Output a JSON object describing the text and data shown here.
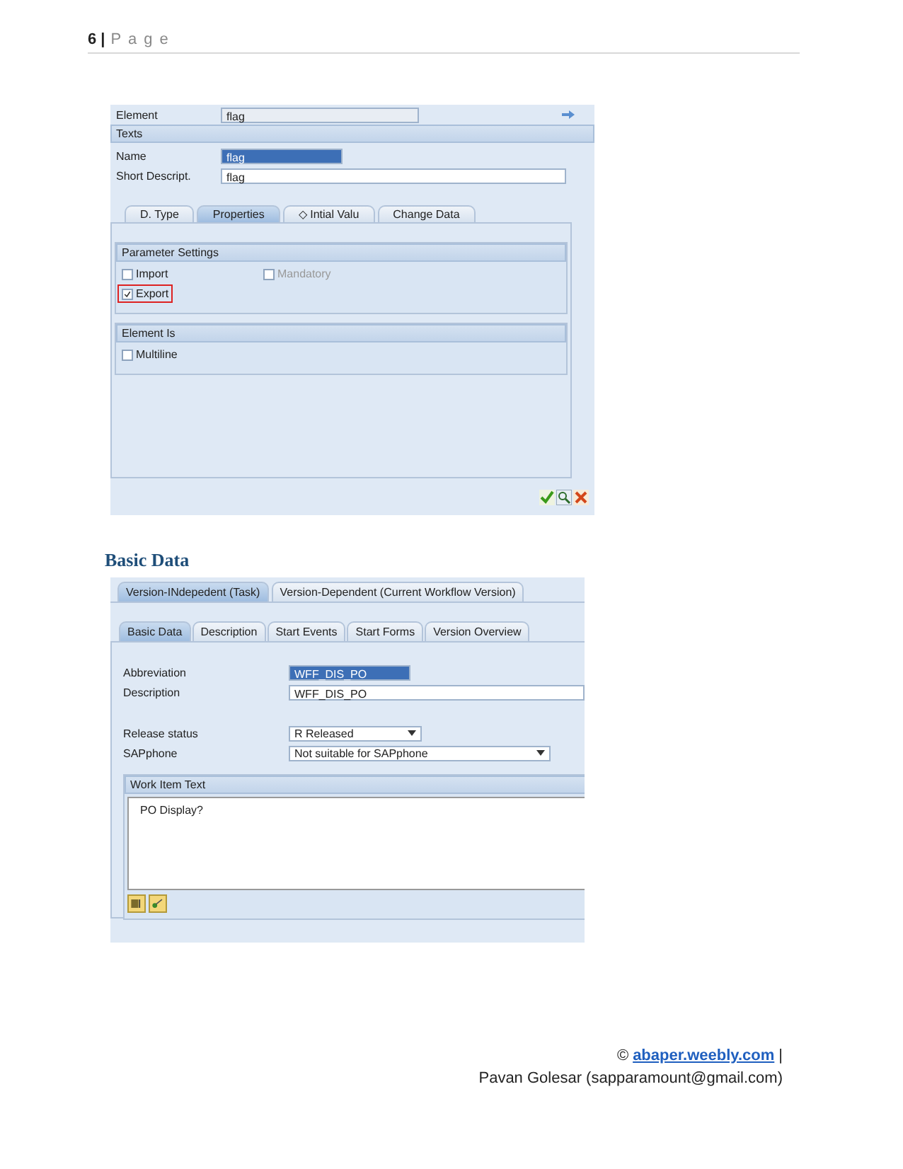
{
  "header": {
    "page_number": "6 |",
    "page_label": "P a g e"
  },
  "element_dialog": {
    "element_label": "Element",
    "element_value": "flag",
    "texts_title": "Texts",
    "fields": [
      {
        "label": "Name",
        "value": "flag",
        "kind": "short-input",
        "highlighted": true
      },
      {
        "label": "Short Descript.",
        "value": "flag",
        "kind": "long-input",
        "highlighted": false
      }
    ],
    "tabs": [
      {
        "label": "D. Type",
        "selected": false
      },
      {
        "label": "Properties",
        "selected": true
      },
      {
        "label": "◇ Intial Valu",
        "selected": false
      },
      {
        "label": "Change Data",
        "selected": false
      }
    ],
    "groups": [
      {
        "title": "Parameter Settings",
        "options": [
          {
            "label": "Import",
            "checked": false,
            "disabled": false,
            "highlighted": false
          },
          {
            "label": "Mandatory",
            "checked": false,
            "disabled": true,
            "highlighted": false
          },
          {
            "label": "Export",
            "checked": true,
            "disabled": false,
            "highlighted": true
          }
        ]
      },
      {
        "title": "Element Is",
        "options": [
          {
            "label": "Multiline",
            "checked": false,
            "disabled": false,
            "highlighted": false
          }
        ]
      }
    ]
  },
  "section_heading": "Basic Data",
  "task_dialog": {
    "outer_tabs": [
      {
        "label": "Version-INdepedent (Task)",
        "selected": true
      },
      {
        "label": "Version-Dependent (Current Workflow Version)",
        "selected": false
      }
    ],
    "inner_tabs": [
      {
        "label": "Basic Data",
        "selected": true
      },
      {
        "label": "Description",
        "selected": false
      },
      {
        "label": "Start Events",
        "selected": false
      },
      {
        "label": "Start Forms",
        "selected": false
      },
      {
        "label": "Version Overview",
        "selected": false
      }
    ],
    "field_groups": [
      [
        {
          "label": "Abbreviation",
          "value": "WFF_DIS_PO",
          "kind": "short-input",
          "highlighted": true
        },
        {
          "label": "Description",
          "value": "WFF_DIS_PO",
          "kind": "long-input",
          "highlighted": false
        }
      ],
      [
        {
          "label": "Release status",
          "value": "R Released",
          "kind": "short-dropdown",
          "highlighted": false
        },
        {
          "label": "SAPphone",
          "value": "Not suitable for SAPphone",
          "kind": "long-dropdown",
          "highlighted": false
        }
      ]
    ],
    "work_item_text": {
      "title": "Work Item Text",
      "text": "PO Display?"
    }
  },
  "footer": {
    "copyright": "©",
    "link": "abaper.weebly.com",
    "separator": "|",
    "author": "Pavan Golesar (sapparamount@gmail.com)"
  }
}
